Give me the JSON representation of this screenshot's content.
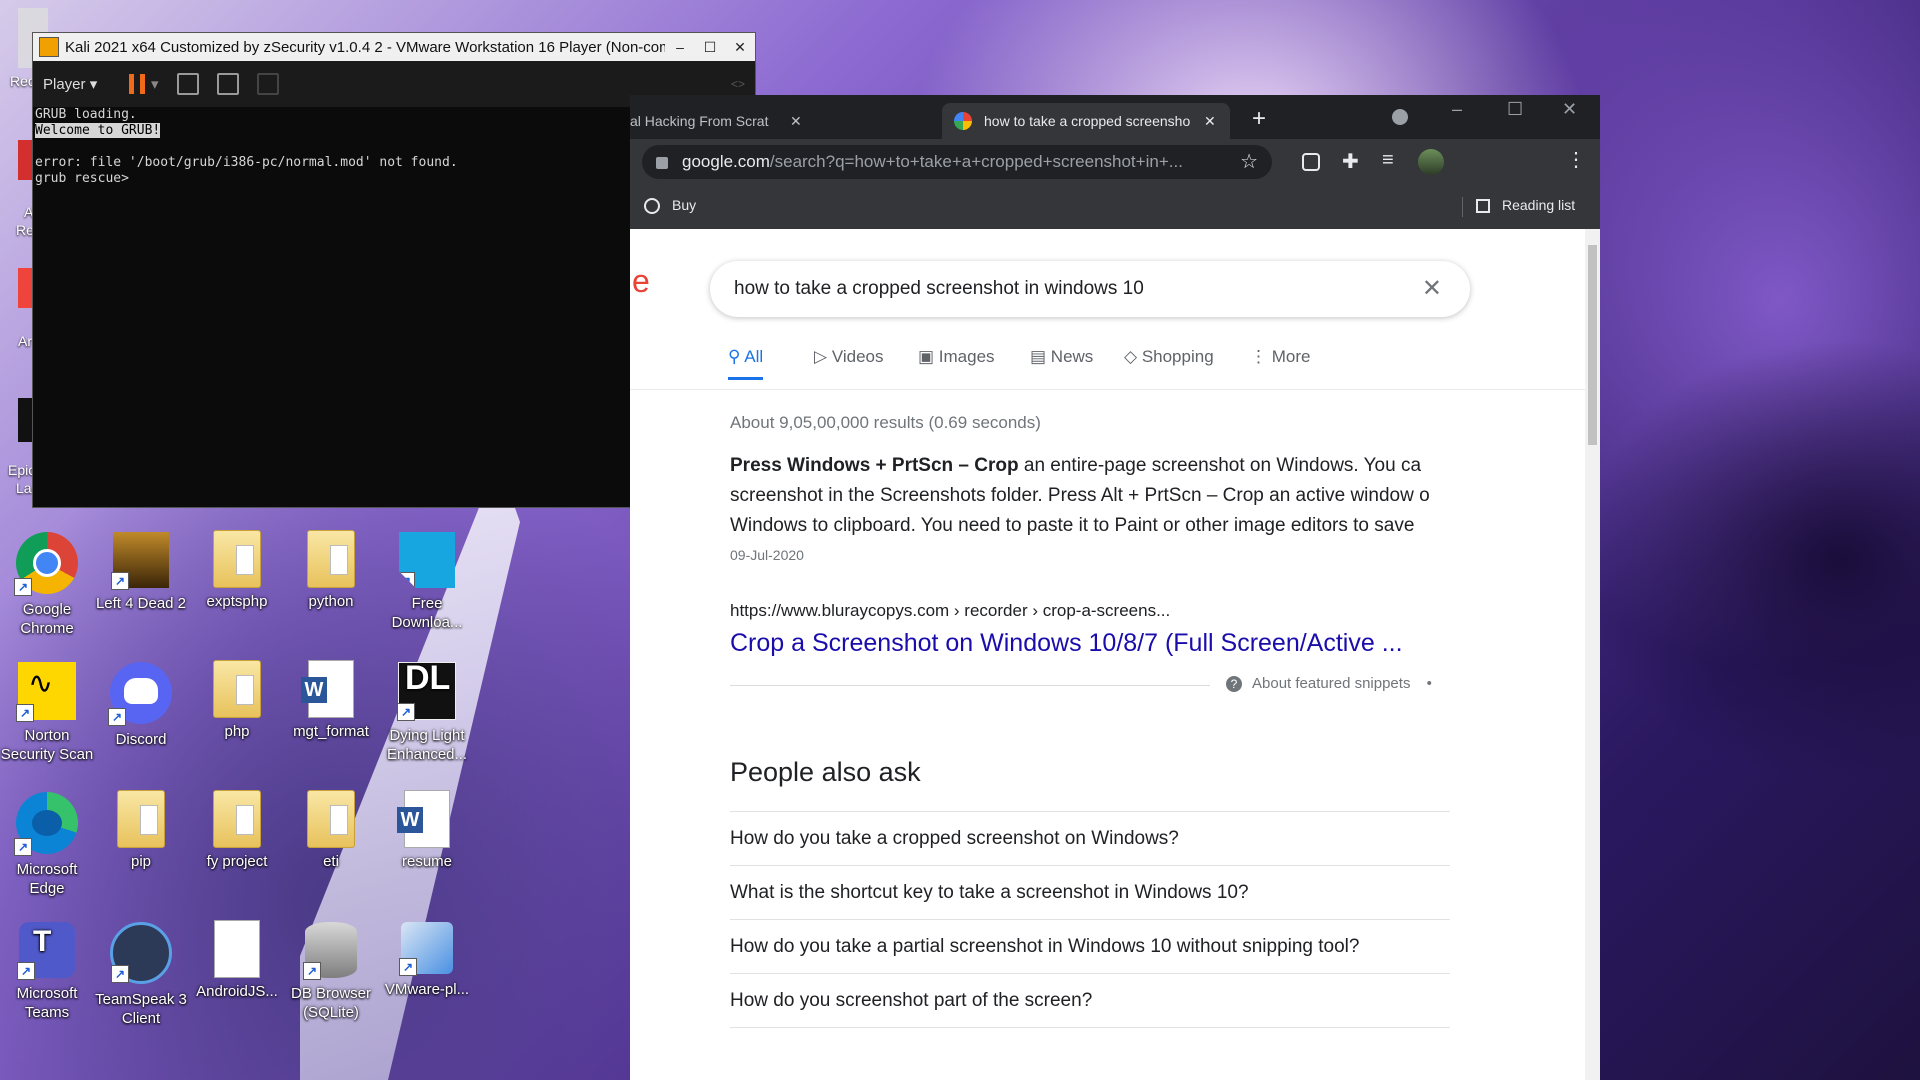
{
  "desktop": {
    "icons": [
      {
        "label": "Google Chrome",
        "icon": "chrome-icon",
        "color": "#4285f4"
      },
      {
        "label": "Left 4 Dead 2",
        "icon": "left4dead2-icon",
        "color": "#6b4a1a"
      },
      {
        "label": "exptsphp",
        "icon": "folder-icon",
        "color": "#f2d27a"
      },
      {
        "label": "python",
        "icon": "folder-icon",
        "color": "#f2d27a"
      },
      {
        "label": "Free Downloa...",
        "icon": "free-download-manager-icon",
        "color": "#18a6e0"
      },
      {
        "label": "Norton Security Scan",
        "icon": "norton-icon",
        "color": "#ffd700"
      },
      {
        "label": "Discord",
        "icon": "discord-icon",
        "color": "#5865f2"
      },
      {
        "label": "php",
        "icon": "folder-icon",
        "color": "#f2d27a"
      },
      {
        "label": "mgt_format",
        "icon": "word-document-icon",
        "color": "#2b579a"
      },
      {
        "label": "Dying Light Enhanced...",
        "icon": "dying-light-icon",
        "color": "#111111"
      },
      {
        "label": "Microsoft Edge",
        "icon": "edge-icon",
        "color": "#0c84d6"
      },
      {
        "label": "pip",
        "icon": "folder-icon",
        "color": "#f2d27a"
      },
      {
        "label": "fy project",
        "icon": "folder-icon",
        "color": "#f2d27a"
      },
      {
        "label": "eti",
        "icon": "folder-icon",
        "color": "#f2d27a"
      },
      {
        "label": "resume",
        "icon": "word-document-icon",
        "color": "#2b579a"
      },
      {
        "label": "Microsoft Teams",
        "icon": "teams-icon",
        "color": "#5059c9"
      },
      {
        "label": "TeamSpeak 3 Client",
        "icon": "teamspeak-icon",
        "color": "#2d3a57"
      },
      {
        "label": "AndroidJS...",
        "icon": "blank-file-icon",
        "color": "#ffffff"
      },
      {
        "label": "DB Browser (SQLite)",
        "icon": "db-browser-icon",
        "color": "#9a9a9a"
      },
      {
        "label": "VMware-pl...",
        "icon": "vmware-installer-icon",
        "color": "#4a90e2"
      }
    ],
    "partial_left_labels": [
      "Rec",
      "A",
      "Re",
      "Ar",
      "Epic",
      "La"
    ]
  },
  "vmware": {
    "title": "Kali 2021 x64 Customized by zSecurity v1.0.4 2 - VMware Workstation 16 Player (Non-comm",
    "minimize": "–",
    "maximize": "☐",
    "close": "✕",
    "player_menu": "Player",
    "terminal_lines": [
      "GRUB loading.",
      "Welcome to GRUB!",
      "",
      "error: file '/boot/grub/i386-pc/normal.mod' not found.",
      "grub rescue>"
    ]
  },
  "chrome": {
    "tabs": [
      {
        "label": "al Hacking From Scrat"
      },
      {
        "label": "how to take a cropped screensho"
      }
    ],
    "new_tab": "+",
    "url_host": "google.com",
    "url_path": "/search?q=how+to+take+a+cropped+screenshot+in+...",
    "bookmark_buy": "Buy",
    "reading_list": "Reading list"
  },
  "google": {
    "logo_fragment": "e",
    "query": "how to take a cropped screenshot in windows 10",
    "tabs": [
      {
        "label": "All",
        "icon": "search-icon",
        "active": true
      },
      {
        "label": "Videos",
        "icon": "video-icon",
        "active": false
      },
      {
        "label": "Images",
        "icon": "image-icon",
        "active": false
      },
      {
        "label": "News",
        "icon": "news-icon",
        "active": false
      },
      {
        "label": "Shopping",
        "icon": "tag-icon",
        "active": false
      },
      {
        "label": "More",
        "icon": "more-vert-icon",
        "active": false
      }
    ],
    "result_stats": "About 9,05,00,000 results (0.69 seconds)",
    "snippet": {
      "bold": "Press Windows + PrtScn – Crop",
      "line1_rest": " an entire-page screenshot on Windows. You ca",
      "line2": "screenshot in the Screenshots folder. Press Alt + PrtScn – Crop an active window o",
      "line3": "Windows to clipboard. You need to paste it to Paint or other image editors to save",
      "date": "09-Jul-2020",
      "cite": "https://www.bluraycopys.com › recorder › crop-a-screens...",
      "link_title": "Crop a Screenshot on Windows 10/8/7 (Full Screen/Active ...",
      "about": "About featured snippets",
      "bullet": "•"
    },
    "paa_heading": "People also ask",
    "paa": [
      "How do you take a cropped screenshot on Windows?",
      "What is the shortcut key to take a screenshot in Windows 10?",
      "How do you take a partial screenshot in Windows 10 without snipping tool?",
      "How do you screenshot part of the screen?"
    ],
    "link_color": "#1a0dab"
  }
}
